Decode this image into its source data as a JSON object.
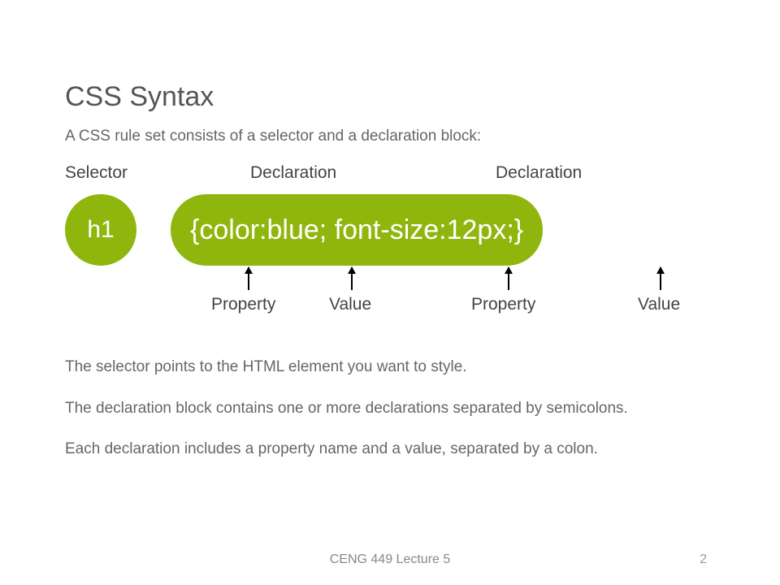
{
  "title": "CSS Syntax",
  "intro": "A CSS rule set consists of a selector and a declaration block:",
  "labels": {
    "selector": "Selector",
    "declaration": "Declaration",
    "property": "Property",
    "value": "Value"
  },
  "example": {
    "selector": "h1",
    "prop1": "color",
    "val1": "blue",
    "prop2": "font-size",
    "val2": "12px",
    "full_declaration": "{color:blue; font-size:12px;}"
  },
  "para1": "The selector points to the HTML element you want to style.",
  "para2": "The declaration block contains one or more declarations separated by semicolons.",
  "para3": "Each declaration includes a property name and a value, separated by a colon.",
  "footer": "CENG 449 Lecture 5",
  "page": "2"
}
